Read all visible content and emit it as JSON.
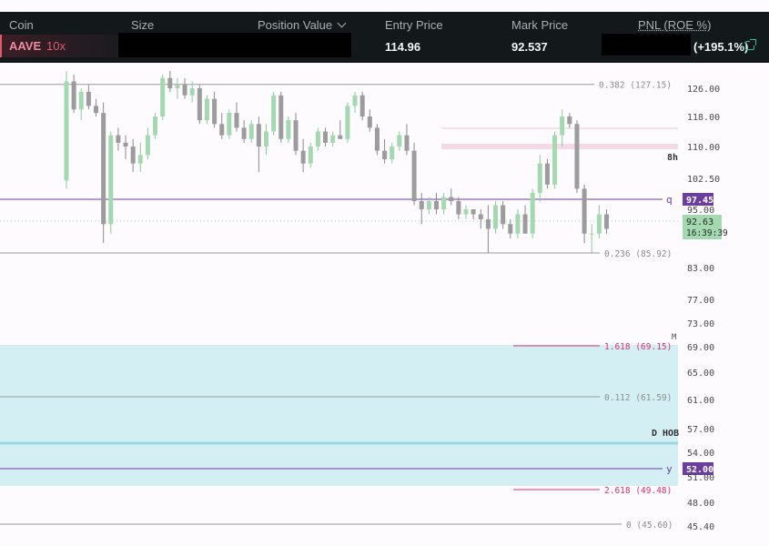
{
  "position_table": {
    "headers": {
      "coin": "Coin",
      "size": "Size",
      "position_value": "Position Value",
      "entry_price": "Entry Price",
      "mark_price": "Mark Price",
      "pnl": "PNL (ROE %)"
    },
    "row": {
      "coin": "AAVE",
      "leverage": "10x",
      "entry_price": "114.96",
      "mark_price": "92.537",
      "pnl_roe": "(+195.1%)"
    }
  },
  "price_axis": {
    "ticks": [
      "126.00",
      "118.00",
      "110.00",
      "102.50",
      "95.00",
      "83.00",
      "77.00",
      "73.00",
      "69.00",
      "65.00",
      "61.00",
      "57.00",
      "54.00",
      "51.00",
      "48.00",
      "45.40"
    ],
    "current_price": "92.63",
    "countdown": "16:39:39",
    "colors": {
      "up": "#a4d8b0",
      "down": "#9c9c9c",
      "purple": "#6a3fa0",
      "pink": "#d6336c",
      "zone": "#cdecf2"
    }
  },
  "fib_levels": [
    {
      "label": "0.382 (127.15)",
      "price": 127.15
    },
    {
      "label": "0.236 (85.92)",
      "price": 85.92
    },
    {
      "label": "1.618 (69.15)",
      "price": 69.15
    },
    {
      "label": "0.112 (61.59)",
      "price": 61.59
    },
    {
      "label": "2.618 (49.48)",
      "price": 49.48
    },
    {
      "label": "0 (45.60)",
      "price": 45.6
    }
  ],
  "horizontal_levels": [
    {
      "tag": "q",
      "price_label": "97.45",
      "price": 97.45
    },
    {
      "tag": "y",
      "price_label": "52.00",
      "price": 52.0
    }
  ],
  "annotations": {
    "timeframe": "8h",
    "zone_label": "D HOB",
    "m_label": "M"
  },
  "candles": [
    [
      102.0,
      131.0,
      100.0,
      128.0
    ],
    [
      128.0,
      130.0,
      119.0,
      120.0
    ],
    [
      120.0,
      126.0,
      117.0,
      125.0
    ],
    [
      125.0,
      127.0,
      120.0,
      121.0
    ],
    [
      121.0,
      123.0,
      118.0,
      119.0
    ],
    [
      119.0,
      122.0,
      88.0,
      92.0
    ],
    [
      92.0,
      114.0,
      90.0,
      113.0
    ],
    [
      113.0,
      115.0,
      109.0,
      111.0
    ],
    [
      111.0,
      113.0,
      107.0,
      110.0
    ],
    [
      110.0,
      112.0,
      104.0,
      106.0
    ],
    [
      106.0,
      111.0,
      104.0,
      108.0
    ],
    [
      108.0,
      115.0,
      107.0,
      113.0
    ],
    [
      113.0,
      119.0,
      112.0,
      118.0
    ],
    [
      118.0,
      130.0,
      117.0,
      129.0
    ],
    [
      129.0,
      131.0,
      125.0,
      126.0
    ],
    [
      126.0,
      129.0,
      123.0,
      127.0
    ],
    [
      127.0,
      129.0,
      123.0,
      124.0
    ],
    [
      124.0,
      128.0,
      122.0,
      126.0
    ],
    [
      126.0,
      127.0,
      116.0,
      117.0
    ],
    [
      117.0,
      124.0,
      116.0,
      123.0
    ],
    [
      123.0,
      125.0,
      115.0,
      116.0
    ],
    [
      116.0,
      119.0,
      112.0,
      113.0
    ],
    [
      113.0,
      120.0,
      112.0,
      119.0
    ],
    [
      119.0,
      122.0,
      114.0,
      115.0
    ],
    [
      115.0,
      117.0,
      111.0,
      112.0
    ],
    [
      112.0,
      117.0,
      111.0,
      116.0
    ],
    [
      116.0,
      118.0,
      104.0,
      110.0
    ],
    [
      110.0,
      116.0,
      108.0,
      114.0
    ],
    [
      114.0,
      125.0,
      113.0,
      124.0
    ],
    [
      124.0,
      125.0,
      111.0,
      112.0
    ],
    [
      112.0,
      118.0,
      111.0,
      117.0
    ],
    [
      117.0,
      119.0,
      108.0,
      109.0
    ],
    [
      109.0,
      112.0,
      104.0,
      106.0
    ],
    [
      106.0,
      111.0,
      105.0,
      110.0
    ],
    [
      110.0,
      115.0,
      109.0,
      114.0
    ],
    [
      114.0,
      115.0,
      110.0,
      111.0
    ],
    [
      111.0,
      114.0,
      110.0,
      113.0
    ],
    [
      113.0,
      117.0,
      112.0,
      112.0
    ],
    [
      112.0,
      122.0,
      111.0,
      121.0
    ],
    [
      121.0,
      125.0,
      119.0,
      124.0
    ],
    [
      124.0,
      125.0,
      117.0,
      118.0
    ],
    [
      118.0,
      120.0,
      114.0,
      115.0
    ],
    [
      115.0,
      116.0,
      108.0,
      109.0
    ],
    [
      109.0,
      112.0,
      106.0,
      107.0
    ],
    [
      107.0,
      111.0,
      106.0,
      110.0
    ],
    [
      110.0,
      114.0,
      109.0,
      113.0
    ],
    [
      113.0,
      116.0,
      108.0,
      109.0
    ],
    [
      109.0,
      111.0,
      96.0,
      97.0
    ],
    [
      97.0,
      99.0,
      92.0,
      95.0
    ],
    [
      95.0,
      98.0,
      94.0,
      97.0
    ],
    [
      97.0,
      99.0,
      94.0,
      95.0
    ],
    [
      95.0,
      99.0,
      94.0,
      98.0
    ],
    [
      98.0,
      100.0,
      96.0,
      97.0
    ],
    [
      97.0,
      98.0,
      93.0,
      94.0
    ],
    [
      94.0,
      96.0,
      93.0,
      95.0
    ],
    [
      95.0,
      95.0,
      93.0,
      94.0
    ],
    [
      94.0,
      95.0,
      91.0,
      93.0
    ],
    [
      93.0,
      96.0,
      86.0,
      91.0
    ],
    [
      91.0,
      97.0,
      90.0,
      96.0
    ],
    [
      96.0,
      97.0,
      91.0,
      92.0
    ],
    [
      92.0,
      93.0,
      89.0,
      90.0
    ],
    [
      90.0,
      95.0,
      89.0,
      94.0
    ],
    [
      94.0,
      96.0,
      90.0,
      90.0
    ],
    [
      90.0,
      100.0,
      89.0,
      99.0
    ],
    [
      99.0,
      108.0,
      97.0,
      106.0
    ],
    [
      106.0,
      107.0,
      100.0,
      101.0
    ],
    [
      101.0,
      114.0,
      100.0,
      113.0
    ],
    [
      113.0,
      120.0,
      110.0,
      118.0
    ],
    [
      118.0,
      119.0,
      115.0,
      116.0
    ],
    [
      116.0,
      117.0,
      99.0,
      100.0
    ],
    [
      100.0,
      101.0,
      88.0,
      90.0
    ],
    [
      90.0,
      92.0,
      86.0,
      90.0
    ],
    [
      90.0,
      96.0,
      89.0,
      94.0
    ],
    [
      94.0,
      95.0,
      90.0,
      91.0
    ]
  ]
}
